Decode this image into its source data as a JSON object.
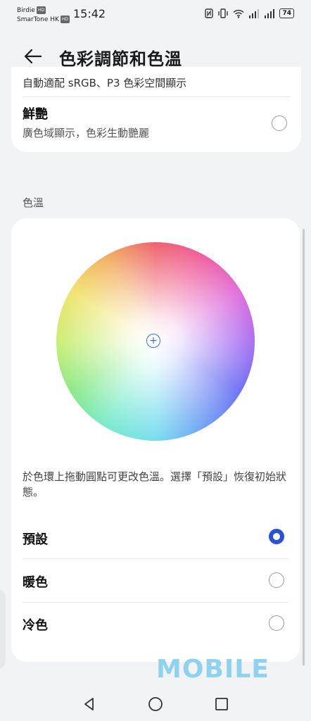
{
  "status_bar": {
    "carrier_1": "Birdie",
    "carrier_2": "SmarTone HK",
    "hd_badge": "HD",
    "time": "15:42",
    "battery": "74",
    "icons": [
      "nfc-icon",
      "vibrate-icon",
      "wifi-icon",
      "signal-icon",
      "signal-icon",
      "battery-icon"
    ]
  },
  "header": {
    "title": "色彩調節和色溫",
    "back_icon": "arrow-left-icon"
  },
  "color_mode_card": {
    "cut_text": "自動適配 sRGB、P3 色彩空間顯示",
    "vivid_title": "鮮艷",
    "vivid_subtitle": "廣色域顯示，色彩生動艷麗",
    "vivid_selected": false
  },
  "color_temperature": {
    "section_label": "色溫",
    "handle_icon": "plus-icon",
    "help_text": "於色環上拖動圓點可更改色溫。選擇「預設」恢復初始狀態。",
    "options": [
      {
        "label": "預設",
        "selected": true
      },
      {
        "label": "暖色",
        "selected": false
      },
      {
        "label": "冷色",
        "selected": false
      }
    ],
    "accent_color": "#2a52d4"
  },
  "watermark": "MOBILE",
  "nav_bar": {
    "icons": [
      "back-triangle-icon",
      "home-circle-icon",
      "recents-square-icon"
    ]
  }
}
